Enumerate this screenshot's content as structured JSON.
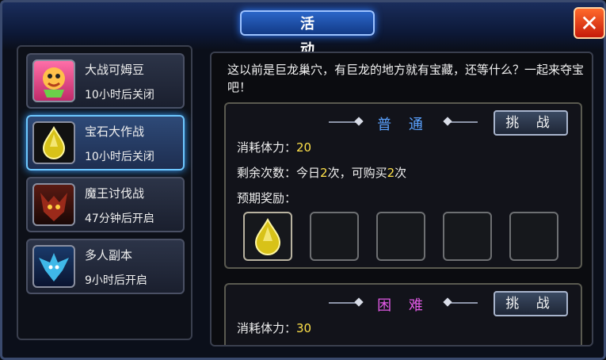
{
  "window": {
    "title": "活 动",
    "close_label": "✕"
  },
  "activities": [
    {
      "name": "大战可姆豆",
      "status": "10小时后关闭",
      "icon": "mascot-icon"
    },
    {
      "name": "宝石大作战",
      "status": "10小时后关闭",
      "icon": "gem-icon",
      "selected": true
    },
    {
      "name": "魔王讨伐战",
      "status": "47分钟后开启",
      "icon": "demon-icon"
    },
    {
      "name": "多人副本",
      "status": "9小时后开启",
      "icon": "dragon-icon"
    }
  ],
  "detail": {
    "description": "这以前是巨龙巢穴，有巨龙的地方就有宝藏，还等什么？一起来夺宝吧！",
    "normal": {
      "title": "普 通",
      "challenge_label": "挑 战",
      "stamina_label": "消耗体力：",
      "stamina_value": "20",
      "remaining_label": "剩余次数：今日",
      "remaining_today": "2",
      "remaining_mid": "次，可购买",
      "remaining_buy": "2",
      "remaining_end": "次",
      "reward_label": "预期奖励："
    },
    "hard": {
      "title": "困 难",
      "challenge_label": "挑 战",
      "stamina_label": "消耗体力：",
      "stamina_value": "30"
    }
  },
  "colors": {
    "normal_title": "#5aa2ff",
    "hard_title": "#e25ae6",
    "accent_yellow": "#ffe14a"
  }
}
